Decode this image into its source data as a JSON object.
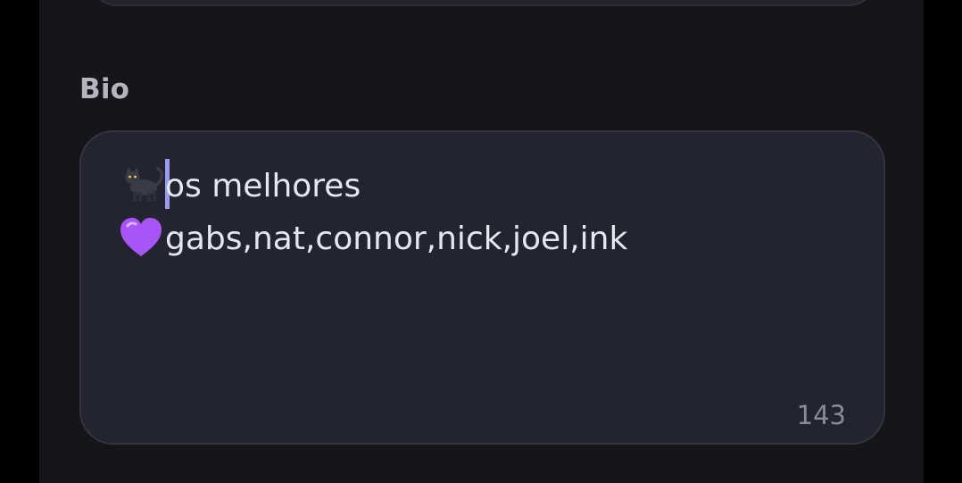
{
  "field": {
    "label": "Bio",
    "line1_emoji": "cat-icon",
    "line1_text": "os melhores",
    "line2_emoji": "purple-heart-icon",
    "line2_text": "gabs,nat,connor,nick,joel,ink",
    "char_count": "143"
  },
  "colors": {
    "panel_bg": "#16161a",
    "input_bg": "#242430",
    "caret": "#9a9cf3",
    "heart": "#a855f7"
  }
}
